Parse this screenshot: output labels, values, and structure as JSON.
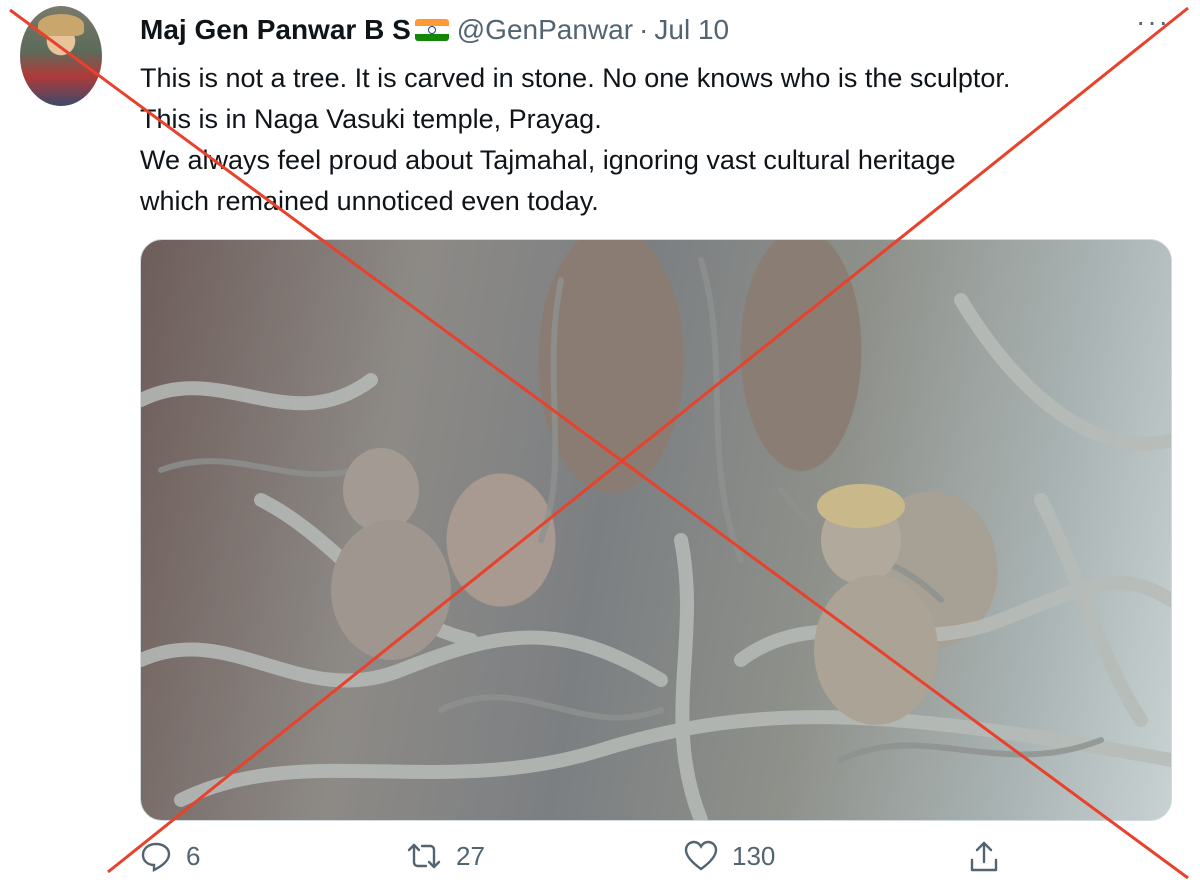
{
  "tweet": {
    "author_name": "Maj Gen Panwar B S",
    "handle": "@GenPanwar",
    "separator": "·",
    "date": "Jul 10",
    "more_glyph": "···",
    "text_lines": [
      "This is not a tree. It is carved in stone. No one knows who is the sculptor.",
      "This is in Naga Vasuki temple, Prayag.",
      "We always feel proud about Tajmahal, ignoring vast cultural heritage",
      "which remained unnoticed even today."
    ],
    "flag_colors": [
      "#ff9933",
      "#ffffff",
      "#138808"
    ],
    "reply_count": "6",
    "retweet_count": "27",
    "like_count": "130"
  },
  "icons": {
    "reply": "reply-icon",
    "retweet": "retweet-icon",
    "like": "heart-icon",
    "share": "share-icon"
  },
  "overlay": {
    "cross_color": "#e8412c"
  }
}
